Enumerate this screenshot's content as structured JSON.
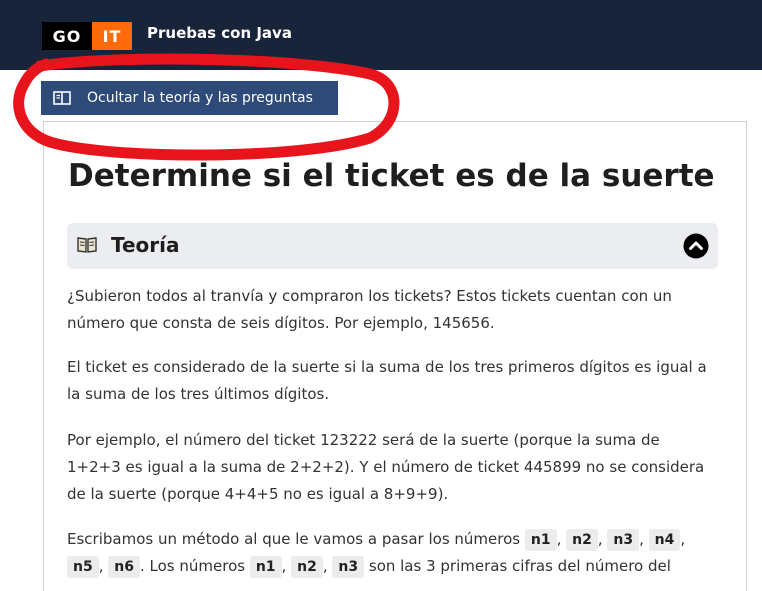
{
  "header": {
    "logo_go": "GO",
    "logo_it": "IT",
    "title": "Pruebas con Java",
    "background_color": "#17243a",
    "logo_accent_color": "#ff6b0a"
  },
  "toolbar": {
    "toggle_label": "Ocultar la teoría y las preguntas",
    "toggle_icon": "book-open-icon",
    "toggle_color": "#2d4a78"
  },
  "annotation": {
    "color": "#e8141c"
  },
  "main": {
    "title": "Determine si el ticket es de la suerte",
    "theory": {
      "label": "Teoría",
      "icon": "book-emoji-icon",
      "toggle_icon": "chevron-up-icon"
    },
    "paragraphs": [
      "¿Subieron todos al tranvía y compraron los tickets? Estos tickets cuentan con un número que consta de seis dígitos. Por ejemplo, 145656.",
      "El ticket es considerado de la suerte si la suma de los tres primeros dígitos es igual a la suma de los tres últimos dígitos.",
      "Por ejemplo, el número del ticket 123222 será de la suerte (porque la suma de 1+2+3 es igual a la suma de 2+2+2). Y el número de ticket 445899 no se considera de la suerte (porque 4+4+5 no es igual a 8+9+9)."
    ],
    "last_paragraph": {
      "text_1": "Escribamos un método al que le vamos a pasar los números",
      "codes_1": [
        "n1",
        "n2",
        "n3",
        "n4",
        "n5",
        "n6"
      ],
      "text_2": ". Los números",
      "codes_2": [
        "n1",
        "n2",
        "n3"
      ],
      "text_3": "son las 3 primeras cifras del número del"
    }
  }
}
